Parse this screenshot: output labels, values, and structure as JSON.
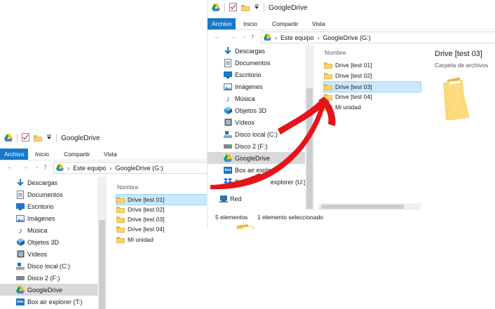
{
  "window_title": "GoogleDrive",
  "ribbon_tabs": [
    "Archivo",
    "Inicio",
    "Compartir",
    "Vista"
  ],
  "address_parts": [
    "Este equipo",
    "GoogleDrive (G:)"
  ],
  "column_header": "Nombre",
  "nav_items": [
    {
      "label": "Descargas",
      "icon": "download-icon"
    },
    {
      "label": "Documentos",
      "icon": "documents-icon"
    },
    {
      "label": "Escritorio",
      "icon": "desktop-icon"
    },
    {
      "label": "Imágenes",
      "icon": "pictures-icon"
    },
    {
      "label": "Música",
      "icon": "music-icon"
    },
    {
      "label": "Objetos 3D",
      "icon": "objects-3d-icon"
    },
    {
      "label": "Vídeos",
      "icon": "videos-icon"
    },
    {
      "label": "Disco local (C:)",
      "icon": "local-disk-icon"
    },
    {
      "label": "Disco 2 (F:)",
      "icon": "drive-icon"
    },
    {
      "label": "GoogleDrive",
      "icon": "google-drive-icon"
    },
    {
      "label": "Box air explorer (T:)",
      "icon": "box-icon"
    },
    {
      "label": "DropBox air explorer (U:)",
      "icon": "dropbox-icon"
    },
    {
      "label": "Red",
      "icon": "network-icon"
    }
  ],
  "win1": {
    "files": [
      "Drive [test 01]",
      "Drive [test 02]",
      "Drive [test 03]",
      "Drive [test 04]",
      "Mi unidad"
    ],
    "selected_index": 0
  },
  "win2": {
    "files": [
      "Drive [test 01]",
      "Drive [test 02]",
      "Drive [test 03]",
      "Drive [test 04]",
      "Mi unidad"
    ],
    "selected_index": 2,
    "nav_labels": {
      "box": "Box air explorer",
      "dropbox_start": "Drop",
      "dropbox_end": "explorer (U:)"
    },
    "status_count": "5 elementos",
    "status_selected": "1 elemento seleccionado",
    "preview_title": "Drive [test 03]",
    "preview_subtitle": "Carpeta de archivos"
  },
  "colors": {
    "accent": "#1979ca",
    "selection": "#cce8ff",
    "arrow": "#e5141b",
    "folder": "#fcd56a"
  }
}
